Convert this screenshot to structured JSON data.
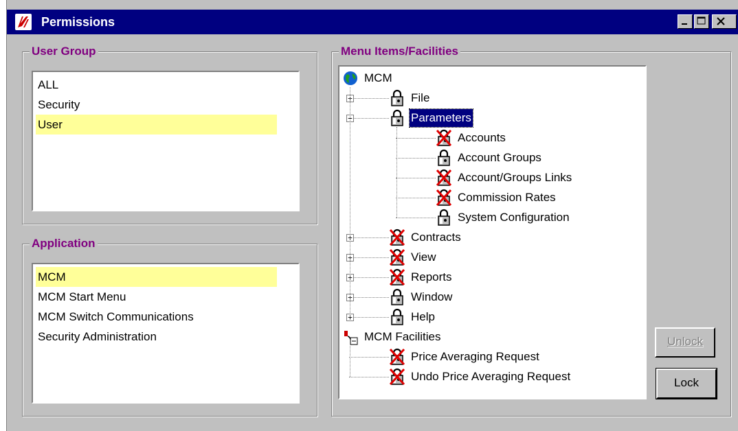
{
  "window": {
    "title": "Permissions"
  },
  "user_group": {
    "label": "User Group",
    "items": [
      {
        "label": "ALL",
        "selected": false
      },
      {
        "label": "Security",
        "selected": false
      },
      {
        "label": "User",
        "selected": true
      }
    ]
  },
  "application": {
    "label": "Application",
    "items": [
      {
        "label": "MCM",
        "selected": true
      },
      {
        "label": "MCM Start Menu",
        "selected": false
      },
      {
        "label": "MCM Switch Communications",
        "selected": false
      },
      {
        "label": "Security Administration",
        "selected": false
      }
    ]
  },
  "menu_items": {
    "label": "Menu Items/Facilities",
    "tree": [
      {
        "label": "MCM",
        "icon": "globe-icon",
        "expander": null,
        "lock": "none",
        "level": 0
      },
      {
        "label": "File",
        "icon": "padlock-icon",
        "expander": "+",
        "lock": "unlocked",
        "level": 1
      },
      {
        "label": "Parameters",
        "icon": "padlock-icon",
        "expander": "-",
        "lock": "unlocked",
        "level": 1,
        "selected": true
      },
      {
        "label": "Accounts",
        "icon": "padlock-icon",
        "expander": null,
        "lock": "locked",
        "level": 2
      },
      {
        "label": "Account Groups",
        "icon": "padlock-icon",
        "expander": null,
        "lock": "unlocked",
        "level": 2
      },
      {
        "label": "Account/Groups Links",
        "icon": "padlock-icon",
        "expander": null,
        "lock": "locked",
        "level": 2
      },
      {
        "label": "Commission Rates",
        "icon": "padlock-icon",
        "expander": null,
        "lock": "locked",
        "level": 2
      },
      {
        "label": "System Configuration",
        "icon": "padlock-icon",
        "expander": null,
        "lock": "unlocked",
        "level": 2
      },
      {
        "label": "Contracts",
        "icon": "padlock-icon",
        "expander": "+",
        "lock": "locked",
        "level": 1
      },
      {
        "label": "View",
        "icon": "padlock-icon",
        "expander": "+",
        "lock": "locked",
        "level": 1
      },
      {
        "label": "Reports",
        "icon": "padlock-icon",
        "expander": "+",
        "lock": "locked",
        "level": 1
      },
      {
        "label": "Window",
        "icon": "padlock-icon",
        "expander": "+",
        "lock": "unlocked",
        "level": 1
      },
      {
        "label": "Help",
        "icon": "padlock-icon",
        "expander": "+",
        "lock": "unlocked",
        "level": 1
      },
      {
        "label": "MCM Facilities",
        "icon": "facilities-icon",
        "expander": null,
        "lock": "none",
        "level": 0
      },
      {
        "label": "Price Averaging Request",
        "icon": "padlock-icon",
        "expander": null,
        "lock": "locked",
        "level": 1
      },
      {
        "label": "Undo Price Averaging Request",
        "icon": "padlock-icon",
        "expander": null,
        "lock": "locked",
        "level": 1
      }
    ]
  },
  "buttons": {
    "unlock": {
      "label": "Unlock",
      "enabled": false
    },
    "lock": {
      "label": "Lock",
      "enabled": true
    }
  },
  "colors": {
    "title_bar": "#000080",
    "group_label": "#800080",
    "selection_highlight": "#ffff99",
    "locked_cross": "#e00000"
  }
}
